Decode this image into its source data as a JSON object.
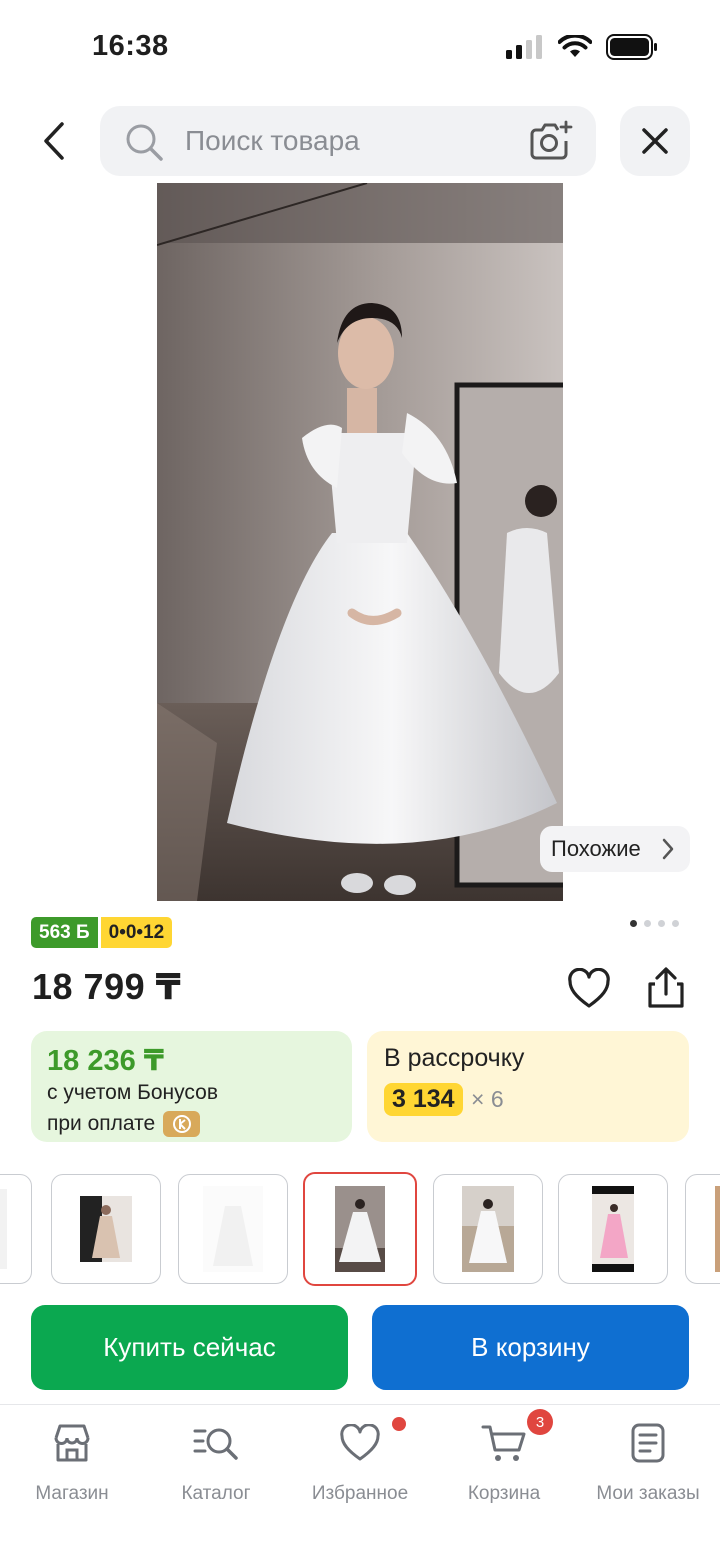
{
  "status_bar": {
    "time": "16:38"
  },
  "search": {
    "placeholder": "Поиск товара"
  },
  "product": {
    "similar_label": "Похожие",
    "bonus_badge": "563 Б",
    "installment_badge": "0•0•12",
    "price": "18 799 ₸",
    "images_count": 4,
    "active_image_index": 0
  },
  "bonus_card": {
    "price_with_bonus": "18 236 ₸",
    "line1": "с учетом Бонусов",
    "line2": "при оплате"
  },
  "installment_card": {
    "title": "В рассрочку",
    "amount": "3 134",
    "multiplier": "× 6"
  },
  "actions": {
    "buy_now": "Купить сейчас",
    "add_to_cart": "В корзину"
  },
  "nav": {
    "items": [
      {
        "label": "Магазин",
        "icon": "store-icon"
      },
      {
        "label": "Каталог",
        "icon": "catalog-search-icon"
      },
      {
        "label": "Избранное",
        "icon": "heart-icon"
      },
      {
        "label": "Корзина",
        "icon": "cart-icon"
      },
      {
        "label": "Мои заказы",
        "icon": "orders-icon"
      }
    ],
    "cart_count": "3"
  },
  "colors": {
    "buy_button": "#0ba850",
    "cart_button": "#0f6fd1",
    "bonus_green": "#3d9a2a",
    "install_yellow": "#ffd633",
    "accent_red": "#e0463f"
  }
}
